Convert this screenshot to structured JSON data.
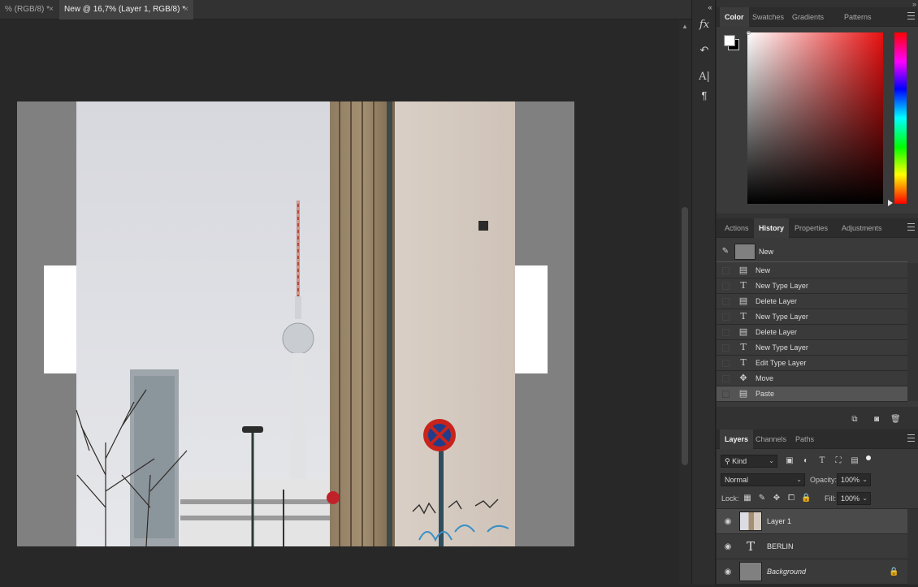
{
  "document_tabs": [
    {
      "title": "% (RGB/8) *",
      "close": "×"
    },
    {
      "title": "New @ 16,7% (Layer 1, RGB/8) *",
      "close": "×"
    }
  ],
  "strip_icons": [
    "fx-icon",
    "history-brush-icon",
    "character-icon",
    "paragraph-icon"
  ],
  "color_panel": {
    "tabs": [
      "Color",
      "Swatches",
      "Gradients",
      "Patterns"
    ],
    "active_tab": "Color",
    "foreground": "#ffffff",
    "background": "#000000",
    "hue_color": "#e81010"
  },
  "history_panel": {
    "tabs": [
      "Actions",
      "History",
      "Properties",
      "Adjustments"
    ],
    "active_tab": "History",
    "snapshot_label": "New",
    "items": [
      {
        "label": "New",
        "icon": "document-icon"
      },
      {
        "label": "New Type Layer",
        "icon": "type-icon"
      },
      {
        "label": "Delete Layer",
        "icon": "document-icon"
      },
      {
        "label": "New Type Layer",
        "icon": "type-icon"
      },
      {
        "label": "Delete Layer",
        "icon": "document-icon"
      },
      {
        "label": "New Type Layer",
        "icon": "type-icon"
      },
      {
        "label": "Edit Type Layer",
        "icon": "type-icon"
      },
      {
        "label": "Move",
        "icon": "move-icon"
      },
      {
        "label": "Paste",
        "icon": "document-icon"
      }
    ],
    "selected_index": 8
  },
  "layers_panel": {
    "tabs": [
      "Layers",
      "Channels",
      "Paths"
    ],
    "active_tab": "Layers",
    "filter_kind": "Kind",
    "blend_mode": "Normal",
    "opacity_label": "Opacity:",
    "opacity_value": "100%",
    "lock_label": "Lock:",
    "fill_label": "Fill:",
    "fill_value": "100%",
    "layers": [
      {
        "name": "Layer 1",
        "type": "image"
      },
      {
        "name": "BERLIN",
        "type": "text"
      },
      {
        "name": "Background",
        "type": "background"
      }
    ],
    "selected_layer": "Layer 1"
  }
}
